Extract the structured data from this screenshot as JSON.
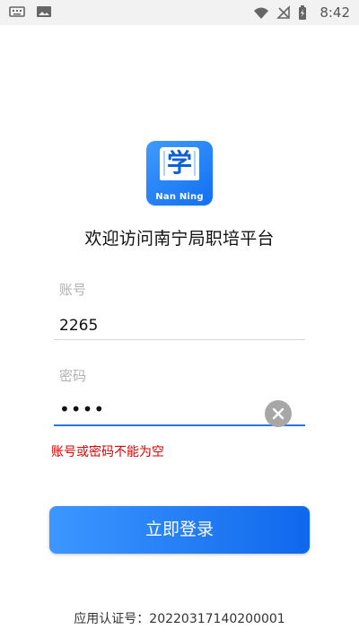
{
  "status_bar": {
    "left_icons": [
      "keyboard-icon",
      "image-icon"
    ],
    "right_icons": [
      "wifi-icon",
      "no-signal-icon",
      "battery-icon"
    ],
    "time": "8:42"
  },
  "logo": {
    "character": "学",
    "text": "Nan Ning"
  },
  "title": "欢迎访问南宁局职培平台",
  "account": {
    "label": "账号",
    "value": "2265"
  },
  "password": {
    "label": "密码",
    "value": "••••",
    "clear_icon": "close-icon"
  },
  "error_message": "账号或密码不能为空",
  "login_button": {
    "label": "立即登录"
  },
  "footer": {
    "label": "应用认证号：",
    "value": "20220317140200001"
  },
  "colors": {
    "primary": "#1F74F2",
    "error": "#E00000",
    "placeholder": "#B0B0B0"
  }
}
